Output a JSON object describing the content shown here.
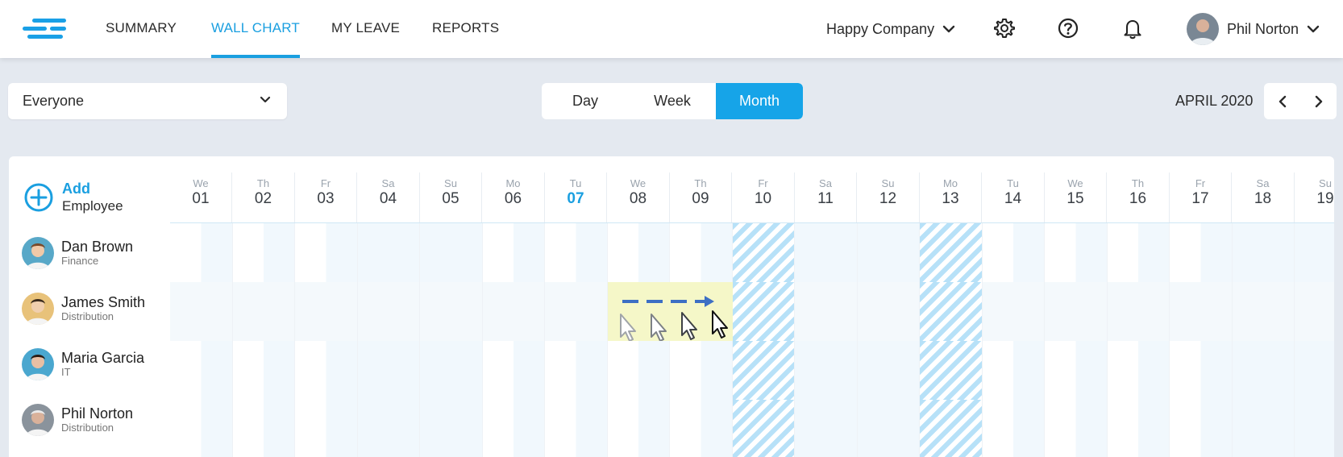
{
  "nav": {
    "links": [
      "SUMMARY",
      "WALL CHART",
      "MY LEAVE",
      "REPORTS"
    ],
    "active_index": 1,
    "company": "Happy Company",
    "user_name": "Phil Norton",
    "icons": [
      "settings-gear-icon",
      "help-icon",
      "notification-bell-icon"
    ]
  },
  "toolbar": {
    "filter_value": "Everyone",
    "views": [
      "Day",
      "Week",
      "Month"
    ],
    "active_view": "Month",
    "month_label": "APRIL 2020"
  },
  "add_employee": {
    "line1": "Add",
    "line2": "Employee"
  },
  "days": [
    {
      "dow": "We",
      "num": "01"
    },
    {
      "dow": "Th",
      "num": "02"
    },
    {
      "dow": "Fr",
      "num": "03"
    },
    {
      "dow": "Sa",
      "num": "04"
    },
    {
      "dow": "Su",
      "num": "05"
    },
    {
      "dow": "Mo",
      "num": "06"
    },
    {
      "dow": "Tu",
      "num": "07",
      "today": true
    },
    {
      "dow": "We",
      "num": "08"
    },
    {
      "dow": "Th",
      "num": "09"
    },
    {
      "dow": "Fr",
      "num": "10",
      "holiday": true
    },
    {
      "dow": "Sa",
      "num": "11"
    },
    {
      "dow": "Su",
      "num": "12"
    },
    {
      "dow": "Mo",
      "num": "13",
      "holiday": true
    },
    {
      "dow": "Tu",
      "num": "14"
    },
    {
      "dow": "We",
      "num": "15"
    },
    {
      "dow": "Th",
      "num": "16"
    },
    {
      "dow": "Fr",
      "num": "17"
    },
    {
      "dow": "Sa",
      "num": "18"
    },
    {
      "dow": "Su",
      "num": "19"
    }
  ],
  "employees": [
    {
      "name": "Dan Brown",
      "dept": "Finance"
    },
    {
      "name": "James Smith",
      "dept": "Distribution"
    },
    {
      "name": "Maria Garcia",
      "dept": "IT"
    },
    {
      "name": "Phil Norton",
      "dept": "Distribution"
    }
  ],
  "colors": {
    "accent": "#1a9fe0",
    "weekend": "#f1f8fd",
    "holiday_hatch": "#b7e1f8",
    "selection": "#f5f7c8"
  }
}
